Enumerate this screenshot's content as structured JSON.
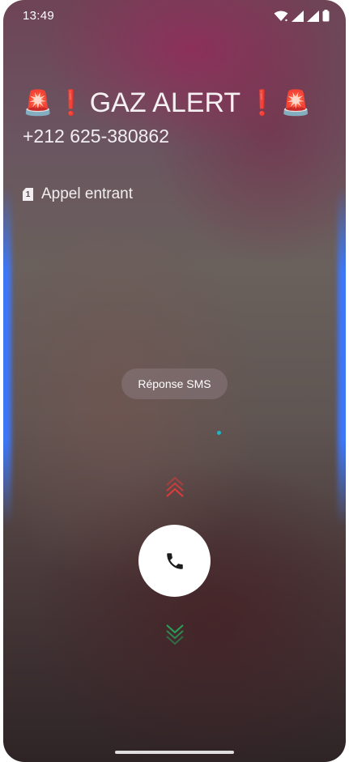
{
  "status_bar": {
    "time": "13:49",
    "icons": [
      "wifi-icon",
      "signal-icon",
      "signal-icon",
      "battery-icon"
    ]
  },
  "call": {
    "siren_emoji": "🚨",
    "exclamation_emoji": "❗",
    "caller_name": "GAZ ALERT",
    "caller_number": "+212 625-380862",
    "sim_slot": "1",
    "status_label": "Appel entrant"
  },
  "actions": {
    "sms_reply_label": "Réponse SMS",
    "answer_icon": "phone-icon",
    "swipe_up_icon": "chevron-up-icon",
    "swipe_down_icon": "chevron-down-icon"
  },
  "colors": {
    "edge_glow": "#3c78ff",
    "accept_chevron": "#e23b3b",
    "decline_chevron": "#27a35a",
    "dot": "#1fb8c8"
  }
}
